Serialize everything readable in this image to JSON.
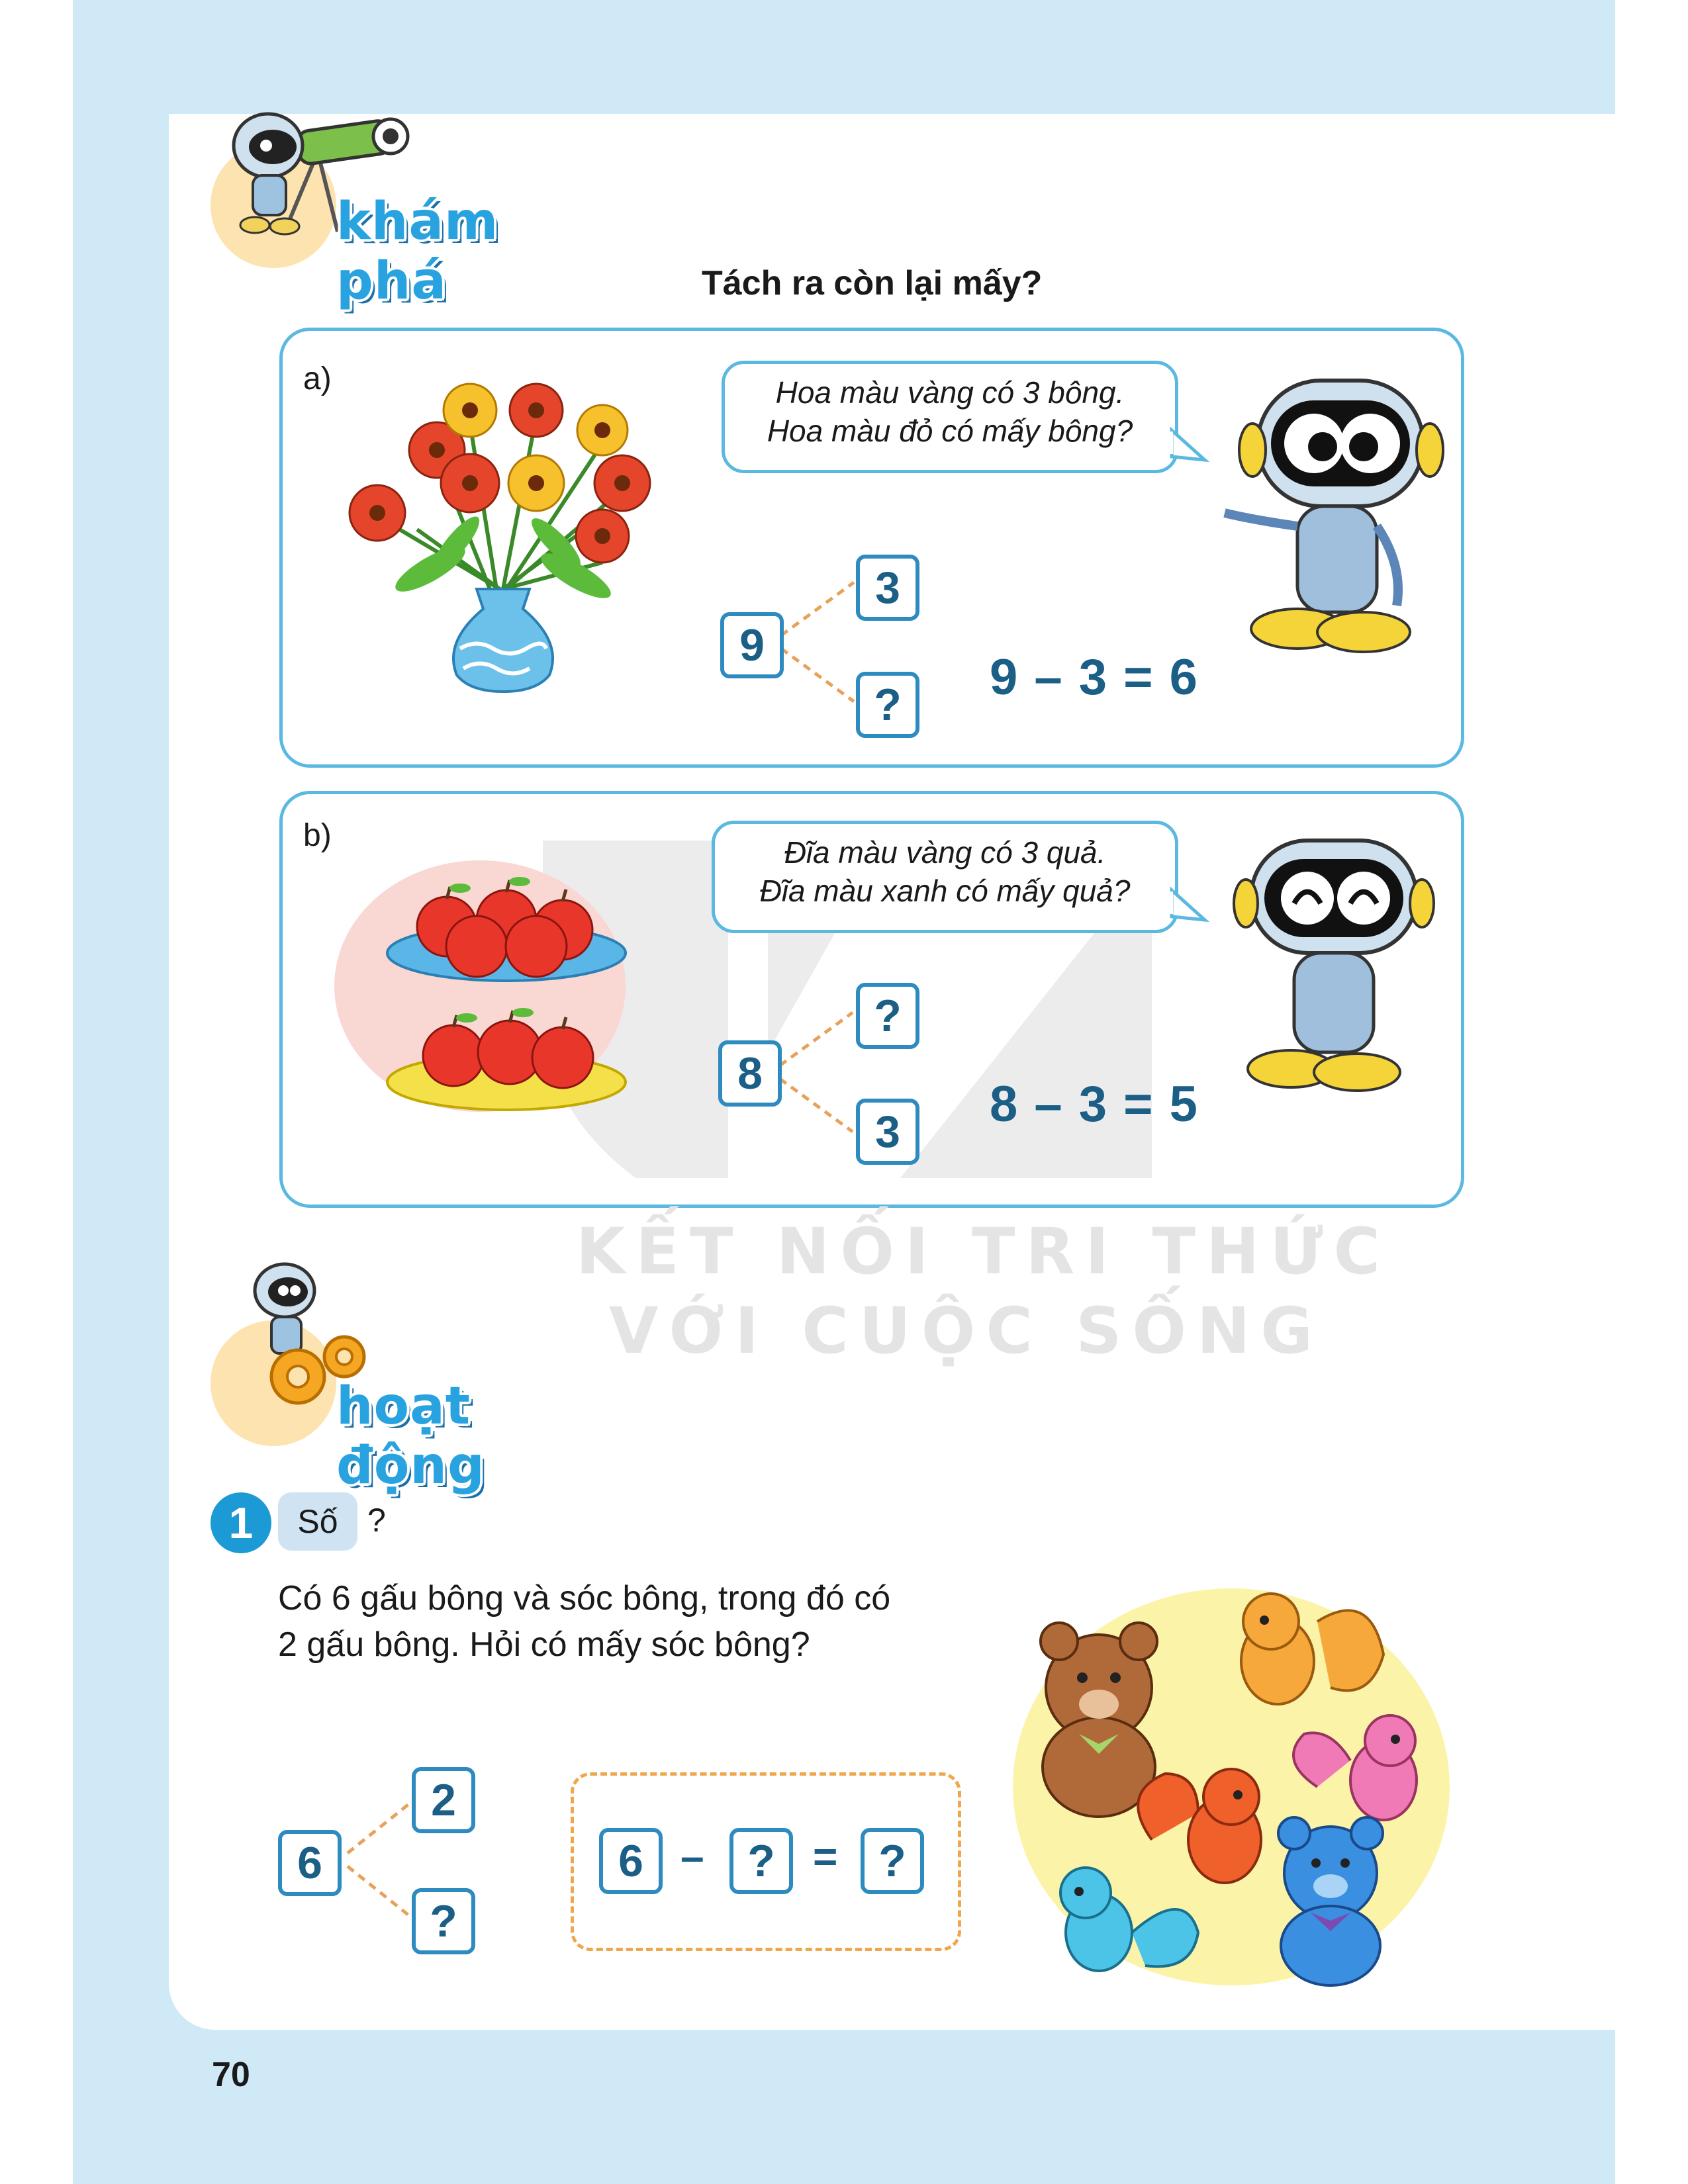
{
  "page": {
    "number": "70"
  },
  "sections": {
    "explore": {
      "title": "khám phá"
    },
    "activity": {
      "title": "hoạt động"
    }
  },
  "subtitle": "Tách ra còn lại mấy?",
  "part_a": {
    "label": "a)",
    "bubble_line1": "Hoa màu vàng có 3 bông.",
    "bubble_line2": "Hoa màu đỏ có mấy bông?",
    "whole": "9",
    "part_top": "3",
    "part_bottom": "?",
    "equation": "9 – 3 = 6"
  },
  "part_b": {
    "label": "b)",
    "bubble_line1": "Đĩa màu vàng có 3 quả.",
    "bubble_line2": "Đĩa màu xanh có mấy quả?",
    "whole": "8",
    "part_top": "?",
    "part_bottom": "3",
    "equation": "8 – 3 = 5"
  },
  "watermark": {
    "line1": "KẾT NỐI TRI THỨC",
    "line2": "VỚI CUỘC SỐNG"
  },
  "exercise1": {
    "number": "1",
    "tag": "Số",
    "question_mark": "?",
    "text_line1": "Có 6 gấu bông và sóc bông, trong đó có",
    "text_line2": "2 gấu bông. Hỏi có mấy sóc bông?",
    "whole": "6",
    "part_top": "2",
    "part_bottom": "?",
    "eq_a": "6",
    "eq_minus": "–",
    "eq_b": "?",
    "eq_equals": "=",
    "eq_c": "?"
  },
  "colors": {
    "accent_blue": "#29a3e0",
    "frame_blue": "#cfe9f7",
    "number_blue": "#1b5e86",
    "dash_orange": "#f0a64a"
  }
}
